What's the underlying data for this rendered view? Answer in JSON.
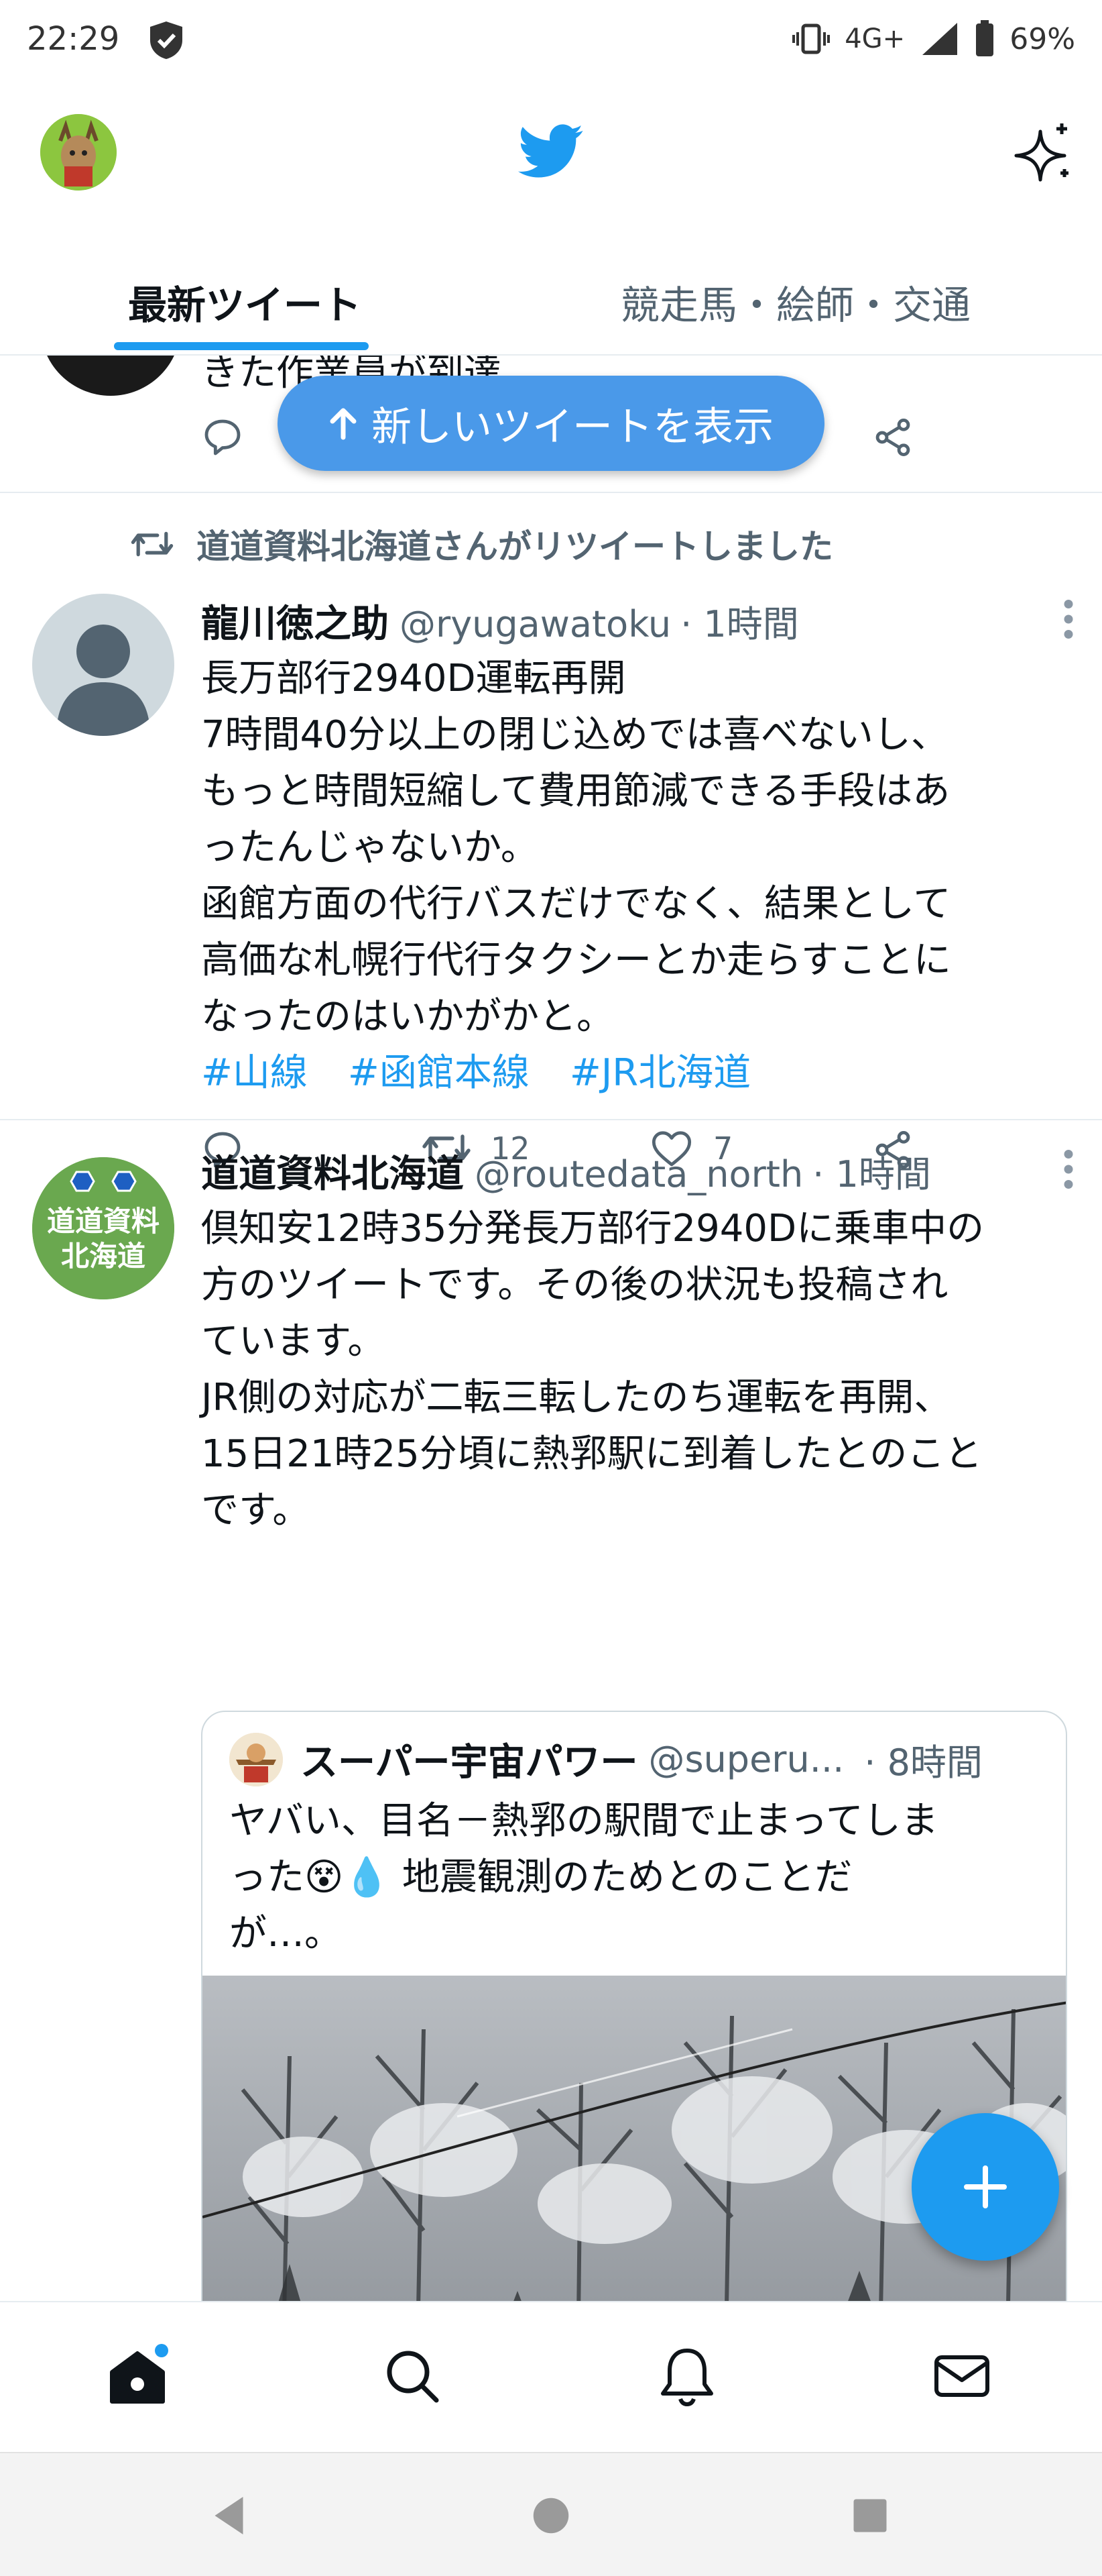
{
  "status_bar": {
    "time": "22:29",
    "network": "4G+",
    "battery": "69%",
    "icons": [
      "shield-icon",
      "vibrate-icon",
      "signal-icon",
      "battery-icon"
    ]
  },
  "header": {
    "icons": [
      "profile-avatar",
      "twitter-bird-icon",
      "sparkle-icon"
    ]
  },
  "tabs": [
    {
      "label": "最新ツイート",
      "active": true
    },
    {
      "label": "競走馬・絵師・交通",
      "active": false
    }
  ],
  "prev_tweet": {
    "partial_text": "きた作業員が到達"
  },
  "new_tweets_pill": {
    "label": "新しいツイートを表示",
    "icon": "arrow-up-icon"
  },
  "tweet1": {
    "retweet_label": "道道資料北海道さんがリツイートしました",
    "name": "龍川徳之助",
    "handle": "@ryugawatoku",
    "time": "· 1時間",
    "text": [
      "長万部行2940D運転再開",
      "7時間40分以上の閉じ込めでは喜べないし、",
      "もっと時間短縮して費用節減できる手段はあ",
      "ったんじゃないか。",
      "函館方面の代行バスだけでなく、結果として",
      "高価な札幌行代行タクシーとか走らすことに",
      "なったのはいかがかと。"
    ],
    "hashtags": [
      "#山線",
      "#函館本線",
      "#JR北海道"
    ],
    "retweets": "12",
    "likes": "7"
  },
  "tweet2": {
    "name": "道道資料北海道",
    "handle": "@routedata_north",
    "time": "· 1時間",
    "avatar_text": [
      "道道資料",
      "北海道"
    ],
    "text": [
      "倶知安12時35分発長万部行2940Dに乗車中の",
      "方のツイートです。その後の状況も投稿され",
      "ています。",
      "JR側の対応が二転三転したのち運転を再開、",
      "15日21時25分頃に熱郛駅に到着したとのこと",
      "です。"
    ],
    "quote": {
      "name": "スーパー宇宙パワー",
      "handle": "@superu...",
      "time": "· 8時間",
      "text": [
        "ヤバい、目名－熱郛の駅間で止まってしま",
        "った😵💧 地震観測のためとのことだ",
        "が…。"
      ]
    }
  },
  "colors": {
    "accent": "#1d9bf0",
    "pill": "#4a99e9",
    "secondary_text": "#536471",
    "divider": "#e6ecf0"
  },
  "bottom_nav": [
    "home-icon",
    "search-icon",
    "bell-icon",
    "mail-icon"
  ],
  "system_nav": [
    "back-icon",
    "home-circle-icon",
    "recents-icon"
  ]
}
